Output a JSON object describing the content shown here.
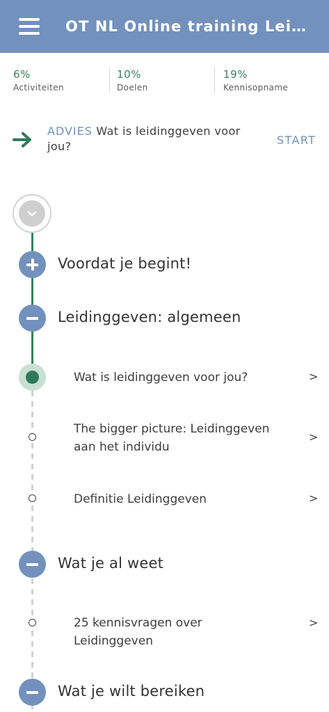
{
  "header": {
    "title": "OT NL Online training Lei…",
    "menu_icon": "hamburger-menu-icon"
  },
  "stats": [
    {
      "value": "6%",
      "label": "Activiteiten"
    },
    {
      "value": "10%",
      "label": "Doelen"
    },
    {
      "value": "19%",
      "label": "Kennisopname"
    }
  ],
  "advice": {
    "tag": "ADVIES",
    "text": " Wat is leidinggeven voor jou?",
    "start_label": "START",
    "arrow_color": "#2f7a5a"
  },
  "sections": [
    {
      "title": "Voordat je begint!",
      "state": "expand"
    },
    {
      "title": "Leidinggeven: algemeen",
      "state": "collapse"
    },
    {
      "title": "Wat je al weet",
      "state": "collapse"
    },
    {
      "title": "Wat je wilt bereiken",
      "state": "collapse"
    }
  ],
  "activities": [
    {
      "title": "Wat is leidinggeven voor jou?",
      "active": true
    },
    {
      "title": "The bigger picture: Leidinggeven aan het individu",
      "active": false
    },
    {
      "title": "Definitie Leidinggeven",
      "active": false
    },
    {
      "title": "25 kennisvragen over Leidinggeven",
      "active": false
    }
  ],
  "chevron": ">",
  "colors": {
    "header": "#7291bd",
    "accent_green": "#3b7f5f",
    "section_button": "#7291bd"
  }
}
